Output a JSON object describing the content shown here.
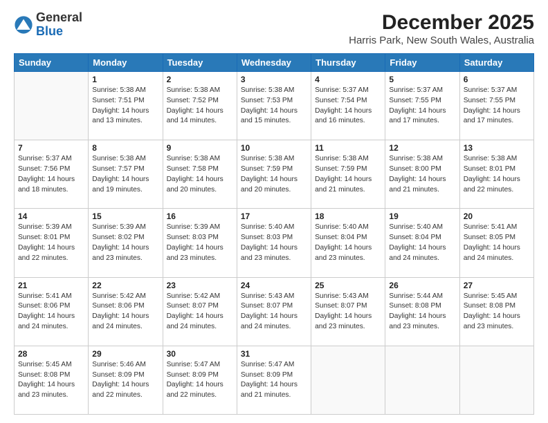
{
  "logo": {
    "general": "General",
    "blue": "Blue"
  },
  "title": "December 2025",
  "subtitle": "Harris Park, New South Wales, Australia",
  "days": [
    "Sunday",
    "Monday",
    "Tuesday",
    "Wednesday",
    "Thursday",
    "Friday",
    "Saturday"
  ],
  "weeks": [
    [
      {
        "day": "",
        "content": ""
      },
      {
        "day": "1",
        "content": "Sunrise: 5:38 AM\nSunset: 7:51 PM\nDaylight: 14 hours\nand 13 minutes."
      },
      {
        "day": "2",
        "content": "Sunrise: 5:38 AM\nSunset: 7:52 PM\nDaylight: 14 hours\nand 14 minutes."
      },
      {
        "day": "3",
        "content": "Sunrise: 5:38 AM\nSunset: 7:53 PM\nDaylight: 14 hours\nand 15 minutes."
      },
      {
        "day": "4",
        "content": "Sunrise: 5:37 AM\nSunset: 7:54 PM\nDaylight: 14 hours\nand 16 minutes."
      },
      {
        "day": "5",
        "content": "Sunrise: 5:37 AM\nSunset: 7:55 PM\nDaylight: 14 hours\nand 17 minutes."
      },
      {
        "day": "6",
        "content": "Sunrise: 5:37 AM\nSunset: 7:55 PM\nDaylight: 14 hours\nand 17 minutes."
      }
    ],
    [
      {
        "day": "7",
        "content": "Sunrise: 5:37 AM\nSunset: 7:56 PM\nDaylight: 14 hours\nand 18 minutes."
      },
      {
        "day": "8",
        "content": "Sunrise: 5:38 AM\nSunset: 7:57 PM\nDaylight: 14 hours\nand 19 minutes."
      },
      {
        "day": "9",
        "content": "Sunrise: 5:38 AM\nSunset: 7:58 PM\nDaylight: 14 hours\nand 20 minutes."
      },
      {
        "day": "10",
        "content": "Sunrise: 5:38 AM\nSunset: 7:59 PM\nDaylight: 14 hours\nand 20 minutes."
      },
      {
        "day": "11",
        "content": "Sunrise: 5:38 AM\nSunset: 7:59 PM\nDaylight: 14 hours\nand 21 minutes."
      },
      {
        "day": "12",
        "content": "Sunrise: 5:38 AM\nSunset: 8:00 PM\nDaylight: 14 hours\nand 21 minutes."
      },
      {
        "day": "13",
        "content": "Sunrise: 5:38 AM\nSunset: 8:01 PM\nDaylight: 14 hours\nand 22 minutes."
      }
    ],
    [
      {
        "day": "14",
        "content": "Sunrise: 5:39 AM\nSunset: 8:01 PM\nDaylight: 14 hours\nand 22 minutes."
      },
      {
        "day": "15",
        "content": "Sunrise: 5:39 AM\nSunset: 8:02 PM\nDaylight: 14 hours\nand 23 minutes."
      },
      {
        "day": "16",
        "content": "Sunrise: 5:39 AM\nSunset: 8:03 PM\nDaylight: 14 hours\nand 23 minutes."
      },
      {
        "day": "17",
        "content": "Sunrise: 5:40 AM\nSunset: 8:03 PM\nDaylight: 14 hours\nand 23 minutes."
      },
      {
        "day": "18",
        "content": "Sunrise: 5:40 AM\nSunset: 8:04 PM\nDaylight: 14 hours\nand 23 minutes."
      },
      {
        "day": "19",
        "content": "Sunrise: 5:40 AM\nSunset: 8:04 PM\nDaylight: 14 hours\nand 24 minutes."
      },
      {
        "day": "20",
        "content": "Sunrise: 5:41 AM\nSunset: 8:05 PM\nDaylight: 14 hours\nand 24 minutes."
      }
    ],
    [
      {
        "day": "21",
        "content": "Sunrise: 5:41 AM\nSunset: 8:06 PM\nDaylight: 14 hours\nand 24 minutes."
      },
      {
        "day": "22",
        "content": "Sunrise: 5:42 AM\nSunset: 8:06 PM\nDaylight: 14 hours\nand 24 minutes."
      },
      {
        "day": "23",
        "content": "Sunrise: 5:42 AM\nSunset: 8:07 PM\nDaylight: 14 hours\nand 24 minutes."
      },
      {
        "day": "24",
        "content": "Sunrise: 5:43 AM\nSunset: 8:07 PM\nDaylight: 14 hours\nand 24 minutes."
      },
      {
        "day": "25",
        "content": "Sunrise: 5:43 AM\nSunset: 8:07 PM\nDaylight: 14 hours\nand 23 minutes."
      },
      {
        "day": "26",
        "content": "Sunrise: 5:44 AM\nSunset: 8:08 PM\nDaylight: 14 hours\nand 23 minutes."
      },
      {
        "day": "27",
        "content": "Sunrise: 5:45 AM\nSunset: 8:08 PM\nDaylight: 14 hours\nand 23 minutes."
      }
    ],
    [
      {
        "day": "28",
        "content": "Sunrise: 5:45 AM\nSunset: 8:08 PM\nDaylight: 14 hours\nand 23 minutes."
      },
      {
        "day": "29",
        "content": "Sunrise: 5:46 AM\nSunset: 8:09 PM\nDaylight: 14 hours\nand 22 minutes."
      },
      {
        "day": "30",
        "content": "Sunrise: 5:47 AM\nSunset: 8:09 PM\nDaylight: 14 hours\nand 22 minutes."
      },
      {
        "day": "31",
        "content": "Sunrise: 5:47 AM\nSunset: 8:09 PM\nDaylight: 14 hours\nand 21 minutes."
      },
      {
        "day": "",
        "content": ""
      },
      {
        "day": "",
        "content": ""
      },
      {
        "day": "",
        "content": ""
      }
    ]
  ]
}
